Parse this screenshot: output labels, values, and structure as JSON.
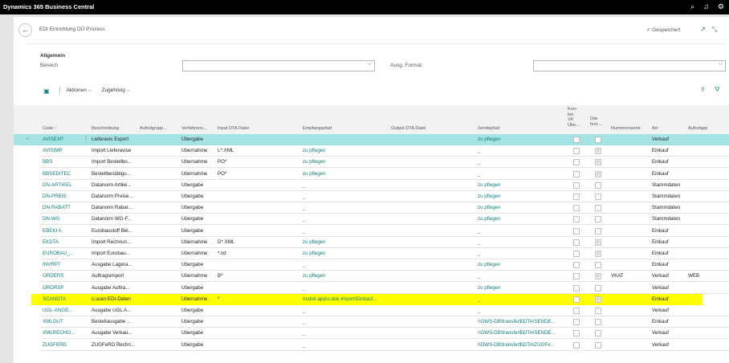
{
  "app": {
    "title": "Dynamics 365 Business Central"
  },
  "icons": {
    "top": [
      "search-icon",
      "bell-icon",
      "gear-icon"
    ]
  },
  "page": {
    "title": "EDI Einrichtung DÜ Prozess",
    "saved": "✓ Gespeichert",
    "general_heading": "Allgemein",
    "field_bereich": "Bereich",
    "field_format": "Ausg. Format",
    "toolbar": {
      "actions": "Aktionen",
      "related": "Zugehörig"
    }
  },
  "table": {
    "headers": {
      "code": "Code ↑",
      "beschreibung": "Beschreibung",
      "aufrufgruppe": "Aufrufgrupp...",
      "verfahren": "Verfahrens...",
      "input": "Input DTA Datei",
      "empfangspfad": "Empfangspfad",
      "output": "Output DTA Datei",
      "sendepfad": "Sendepfad",
      "konv": "Kon-\nbei\nVK\nÜbe...",
      "dat": "Dat-\nfest-...",
      "nummernserie": "Nummernserie",
      "art": "Art",
      "aufrufapp": "Aufrufapp"
    },
    "rows": [
      {
        "code": "AVISEXP",
        "beschreibung": "Lieferavis Export",
        "verfahren": "Übergabe",
        "input": "",
        "empfang": "",
        "empfang_link": false,
        "sende": "zu pflegen",
        "sende_link": true,
        "konv": false,
        "dat": false,
        "nummer": "",
        "art": "Verkauf",
        "app": "",
        "selected": true
      },
      {
        "code": "AVISIMP",
        "beschreibung": "Import Lieferavise",
        "verfahren": "Übernahme",
        "input": "L*.XML",
        "empfang": "zu pflegen",
        "empfang_link": true,
        "sende": "_",
        "sende_link": true,
        "konv": false,
        "dat": true,
        "nummer": "",
        "art": "Einkauf",
        "app": ""
      },
      {
        "code": "BBS",
        "beschreibung": "Import Bestellbo...",
        "verfahren": "Übernahme",
        "input": "PO*",
        "empfang": "zu pflegen",
        "empfang_link": true,
        "sende": "_",
        "sende_link": true,
        "konv": false,
        "dat": true,
        "nummer": "",
        "art": "Einkauf",
        "app": ""
      },
      {
        "code": "BBSEDITEC",
        "beschreibung": "Bestellbestätigu...",
        "verfahren": "Übernahme",
        "input": "PO*",
        "empfang": "zu pflegen",
        "empfang_link": true,
        "sende": "_",
        "sende_link": true,
        "konv": false,
        "dat": true,
        "nummer": "",
        "art": "Einkauf",
        "app": ""
      },
      {
        "code": "DN-ARTIKEL",
        "beschreibung": "Datanorm Artike...",
        "verfahren": "Übergabe",
        "input": "",
        "empfang": "_",
        "empfang_link": true,
        "sende": "zu pflegen",
        "sende_link": true,
        "konv": false,
        "dat": false,
        "nummer": "",
        "art": "Stammdaten",
        "app": ""
      },
      {
        "code": "DN-PREIS",
        "beschreibung": "Datanorm Preise...",
        "verfahren": "Übergabe",
        "input": "",
        "empfang": "_",
        "empfang_link": true,
        "sende": "zu pflegen",
        "sende_link": true,
        "konv": false,
        "dat": false,
        "nummer": "",
        "art": "Stammdaten",
        "app": ""
      },
      {
        "code": "DN-RABATT",
        "beschreibung": "Datanorm Rabat...",
        "verfahren": "Übergabe",
        "input": "",
        "empfang": "_",
        "empfang_link": true,
        "sende": "zu pflegen",
        "sende_link": true,
        "konv": false,
        "dat": false,
        "nummer": "",
        "art": "Stammdaten",
        "app": ""
      },
      {
        "code": "DN-WG",
        "beschreibung": "Datanorm WG-F...",
        "verfahren": "Übergabe",
        "input": "",
        "empfang": "_",
        "empfang_link": true,
        "sende": "zu pflegen",
        "sende_link": true,
        "konv": false,
        "dat": false,
        "nummer": "",
        "art": "Stammdaten",
        "app": ""
      },
      {
        "code": "EBEKI A",
        "beschreibung": "Eurobaustoff Bel...",
        "verfahren": "Übergabe",
        "input": "",
        "empfang": "_",
        "empfang_link": true,
        "sende": "_",
        "sende_link": true,
        "konv": false,
        "dat": false,
        "nummer": "",
        "art": "Einkauf",
        "app": ""
      },
      {
        "code": "EKDTA",
        "beschreibung": "Import Rechnun...",
        "verfahren": "Übernahme",
        "input": "D*.XML",
        "empfang": "zu pflegen",
        "empfang_link": true,
        "sende": "_",
        "sende_link": true,
        "konv": false,
        "dat": true,
        "nummer": "",
        "art": "Einkauf",
        "app": ""
      },
      {
        "code": "EUROBAU_...",
        "beschreibung": "Import Eurobau...",
        "verfahren": "Übernahme",
        "input": "*.txt",
        "empfang": "zu pflegen",
        "empfang_link": true,
        "sende": "_",
        "sende_link": true,
        "konv": false,
        "dat": true,
        "nummer": "",
        "art": "Einkauf",
        "app": ""
      },
      {
        "code": "INVRPT",
        "beschreibung": "Ausgabe Lagera...",
        "verfahren": "Übergabe",
        "input": "",
        "empfang": "_",
        "empfang_link": true,
        "sende": "zu pflegen",
        "sende_link": true,
        "konv": false,
        "dat": false,
        "nummer": "",
        "art": "Einkauf",
        "app": ""
      },
      {
        "code": "ORDERS",
        "beschreibung": "Auftragsimport",
        "verfahren": "Übernahme",
        "input": "B*",
        "empfang": "zu pflegen",
        "empfang_link": true,
        "sende": "_",
        "sende_link": true,
        "konv": false,
        "dat": true,
        "nummer": "VKAT",
        "art": "Verkauf",
        "app": "WEB"
      },
      {
        "code": "ORDRSP",
        "beschreibung": "Ausgabe Auftra...",
        "verfahren": "Übergabe",
        "input": "",
        "empfang": "_",
        "empfang_link": true,
        "sende": "zu pflegen",
        "sende_link": true,
        "konv": false,
        "dat": false,
        "nummer": "",
        "art": "Verkauf",
        "app": ""
      },
      {
        "code": "SCANDTA",
        "beschreibung": "s.scan-EDI-Daten",
        "verfahren": "Übernahme",
        "input": "*",
        "empfang": "\\\\sdok-app\\s.dok-Import\\Einkauf...",
        "empfang_link": true,
        "sende": "_",
        "sende_link": true,
        "konv": false,
        "dat": true,
        "nummer": "",
        "art": "Einkauf",
        "app": "",
        "highlight": true
      },
      {
        "code": "UGL-ANGE...",
        "beschreibung": "Ausgabe UGL A...",
        "verfahren": "Übergabe",
        "input": "",
        "empfang": "_",
        "empfang_link": true,
        "sende": "_",
        "sende_link": true,
        "konv": false,
        "dat": false,
        "nummer": "",
        "art": "Verkauf",
        "app": ""
      },
      {
        "code": "XMLOUT",
        "beschreibung": "Bestellausgabe ...",
        "verfahren": "Übergabe",
        "input": "",
        "empfang": "_",
        "empfang_link": true,
        "sende": "\\\\GWS-DB\\transfer$\\DTA\\SENDE...",
        "sende_link": true,
        "konv": false,
        "dat": false,
        "nummer": "",
        "art": "Einkauf",
        "app": ""
      },
      {
        "code": "XMLRECHO...",
        "beschreibung": "Ausgabe Verkau...",
        "verfahren": "Übergabe",
        "input": "",
        "empfang": "_",
        "empfang_link": true,
        "sende": "\\\\GWS-DB\\transfer$\\DTA\\SENDE...",
        "sende_link": true,
        "konv": false,
        "dat": false,
        "nummer": "",
        "art": "Verkauf",
        "app": ""
      },
      {
        "code": "ZUGFERD",
        "beschreibung": "ZUGFeRD Rechn...",
        "verfahren": "Übergabe",
        "input": "",
        "empfang": "_",
        "empfang_link": true,
        "sende": "\\\\GWS-DB\\transfer$\\DTA\\ZUGFe...",
        "sende_link": true,
        "konv": false,
        "dat": false,
        "nummer": "",
        "art": "Verkauf",
        "app": ""
      }
    ]
  },
  "colors": {
    "accent": "#0f7c7b",
    "selected_row": "#a5e3e5",
    "highlight_row": "#ffff00"
  }
}
